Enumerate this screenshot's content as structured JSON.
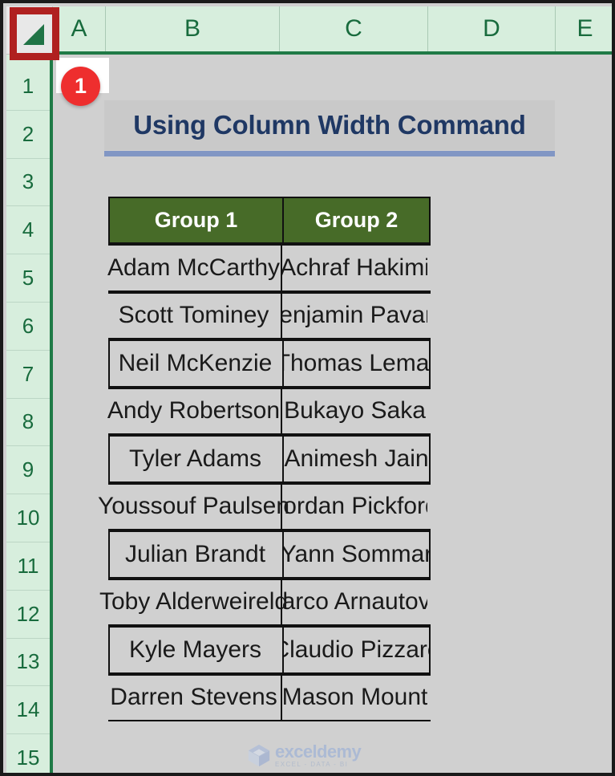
{
  "app": {
    "select_all_label": "Select All",
    "badge_number": "1"
  },
  "grid": {
    "column_headers": [
      "A",
      "B",
      "C",
      "D",
      "E"
    ],
    "row_headers": [
      "1",
      "2",
      "3",
      "4",
      "5",
      "6",
      "7",
      "8",
      "9",
      "10",
      "11",
      "12",
      "13",
      "14",
      "15"
    ]
  },
  "title": {
    "text": "Using Column Width Command"
  },
  "table": {
    "headers": [
      "Group 1",
      "Group 2"
    ],
    "rows": [
      {
        "group1": "Adam McCarthy",
        "group2": "Achraf Hakimi",
        "boxed": false
      },
      {
        "group1": "Scott Tominey",
        "group2": "Benjamin Pavard",
        "boxed": false
      },
      {
        "group1": "Neil McKenzie",
        "group2": "Thomas Lemar",
        "boxed": true
      },
      {
        "group1": "Andy Robertson",
        "group2": "Bukayo Saka",
        "boxed": false
      },
      {
        "group1": "Tyler Adams",
        "group2": "Animesh Jain",
        "boxed": true
      },
      {
        "group1": "Youssouf Paulsen",
        "group2": "Jordan Pickford",
        "boxed": false
      },
      {
        "group1": "Julian Brandt",
        "group2": "Yann Sommar",
        "boxed": true
      },
      {
        "group1": "Toby Alderweireld",
        "group2": "Marco Arnautovic",
        "boxed": false
      },
      {
        "group1": "Kyle Mayers",
        "group2": "Claudio Pizzaro",
        "boxed": true
      },
      {
        "group1": "Darren Stevens",
        "group2": "Mason Mount",
        "boxed": false
      }
    ]
  },
  "watermark": {
    "name": "exceldemy",
    "tagline": "EXCEL - DATA - BI"
  },
  "colors": {
    "header_green": "#476B28",
    "sheet_tab_green": "#1f7a46",
    "row_header_bg": "#d7eedd",
    "title_navy": "#1f3864",
    "title_rule": "#8196c4",
    "badge_red": "#ee2e2e",
    "highlight_red": "#b02020",
    "sheet_bg": "#d0d0d0"
  }
}
